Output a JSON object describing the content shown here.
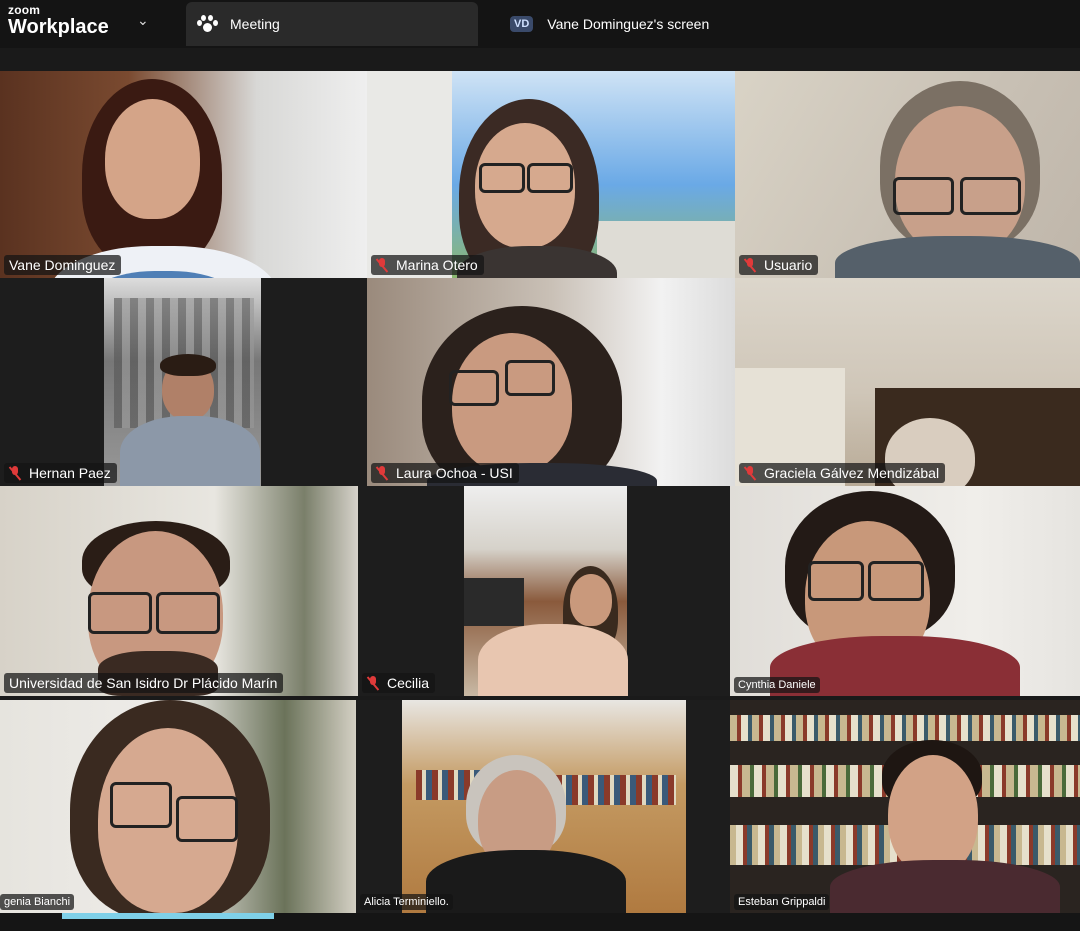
{
  "app": {
    "logo_small": "zoom",
    "logo_big": "Workplace"
  },
  "tabs": [
    {
      "label": "Meeting",
      "icon": "paw-icon"
    },
    {
      "label": "Vane Dominguez's screen",
      "badge": "VD"
    }
  ],
  "participants": [
    {
      "name": "Vane Dominguez",
      "muted": false,
      "active_speaker": true
    },
    {
      "name": "Marina Otero",
      "muted": true
    },
    {
      "name": "Usuario",
      "muted": true
    },
    {
      "name": "Hernan Paez",
      "muted": true
    },
    {
      "name": "Laura Ochoa - USI",
      "muted": true
    },
    {
      "name": "Graciela Gálvez Mendizábal",
      "muted": true
    },
    {
      "name": "Universidad de San Isidro Dr Plácido Marín",
      "muted": false
    },
    {
      "name": "Cecilia",
      "muted": true
    },
    {
      "name": "Cynthia Daniele",
      "muted": false
    },
    {
      "name": "genia Bianchi",
      "muted": false
    },
    {
      "name": "Alicia Terminiello.",
      "muted": false
    },
    {
      "name": "Esteban Grippaldi",
      "muted": false
    }
  ],
  "colors": {
    "active_speaker_border": "#35d06b",
    "muted_icon": "#e03a3a"
  }
}
